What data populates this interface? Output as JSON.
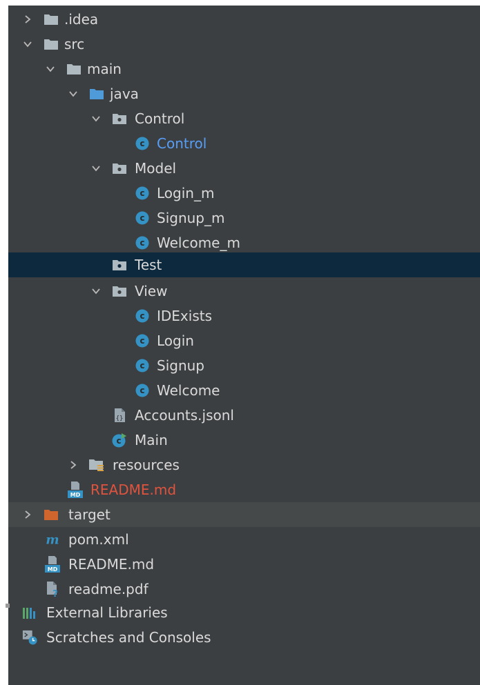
{
  "project_tree": {
    "idea": ".idea",
    "src": "src",
    "main": "main",
    "java": "java",
    "control_pkg": "Control",
    "control_class": "Control",
    "model_pkg": "Model",
    "login_m": "Login_m",
    "signup_m": "Signup_m",
    "welcome_m": "Welcome_m",
    "test_pkg": "Test",
    "view_pkg": "View",
    "idexists": "IDExists",
    "login": "Login",
    "signup": "Signup",
    "welcome": "Welcome",
    "accounts": "Accounts.jsonl",
    "main_class": "Main",
    "resources": "resources",
    "readme_inner": "README.md",
    "target": "target",
    "pom": "pom.xml",
    "readme_root": "README.md",
    "readme_pdf": "readme.pdf",
    "external_libraries": "External Libraries",
    "scratches": "Scratches and Consoles"
  },
  "colors": {
    "panel_bg": "#3c3f41",
    "selected_row": "#0d293e",
    "excluded_row": "#45494a",
    "class_icon": "#3592c4",
    "folder_grey": "#aeb9c0",
    "source_folder_blue": "#4f9ad8",
    "excluded_folder_orange": "#d0662e",
    "modified_text_blue": "#589df6",
    "untracked_text_red": "#e0533e"
  }
}
